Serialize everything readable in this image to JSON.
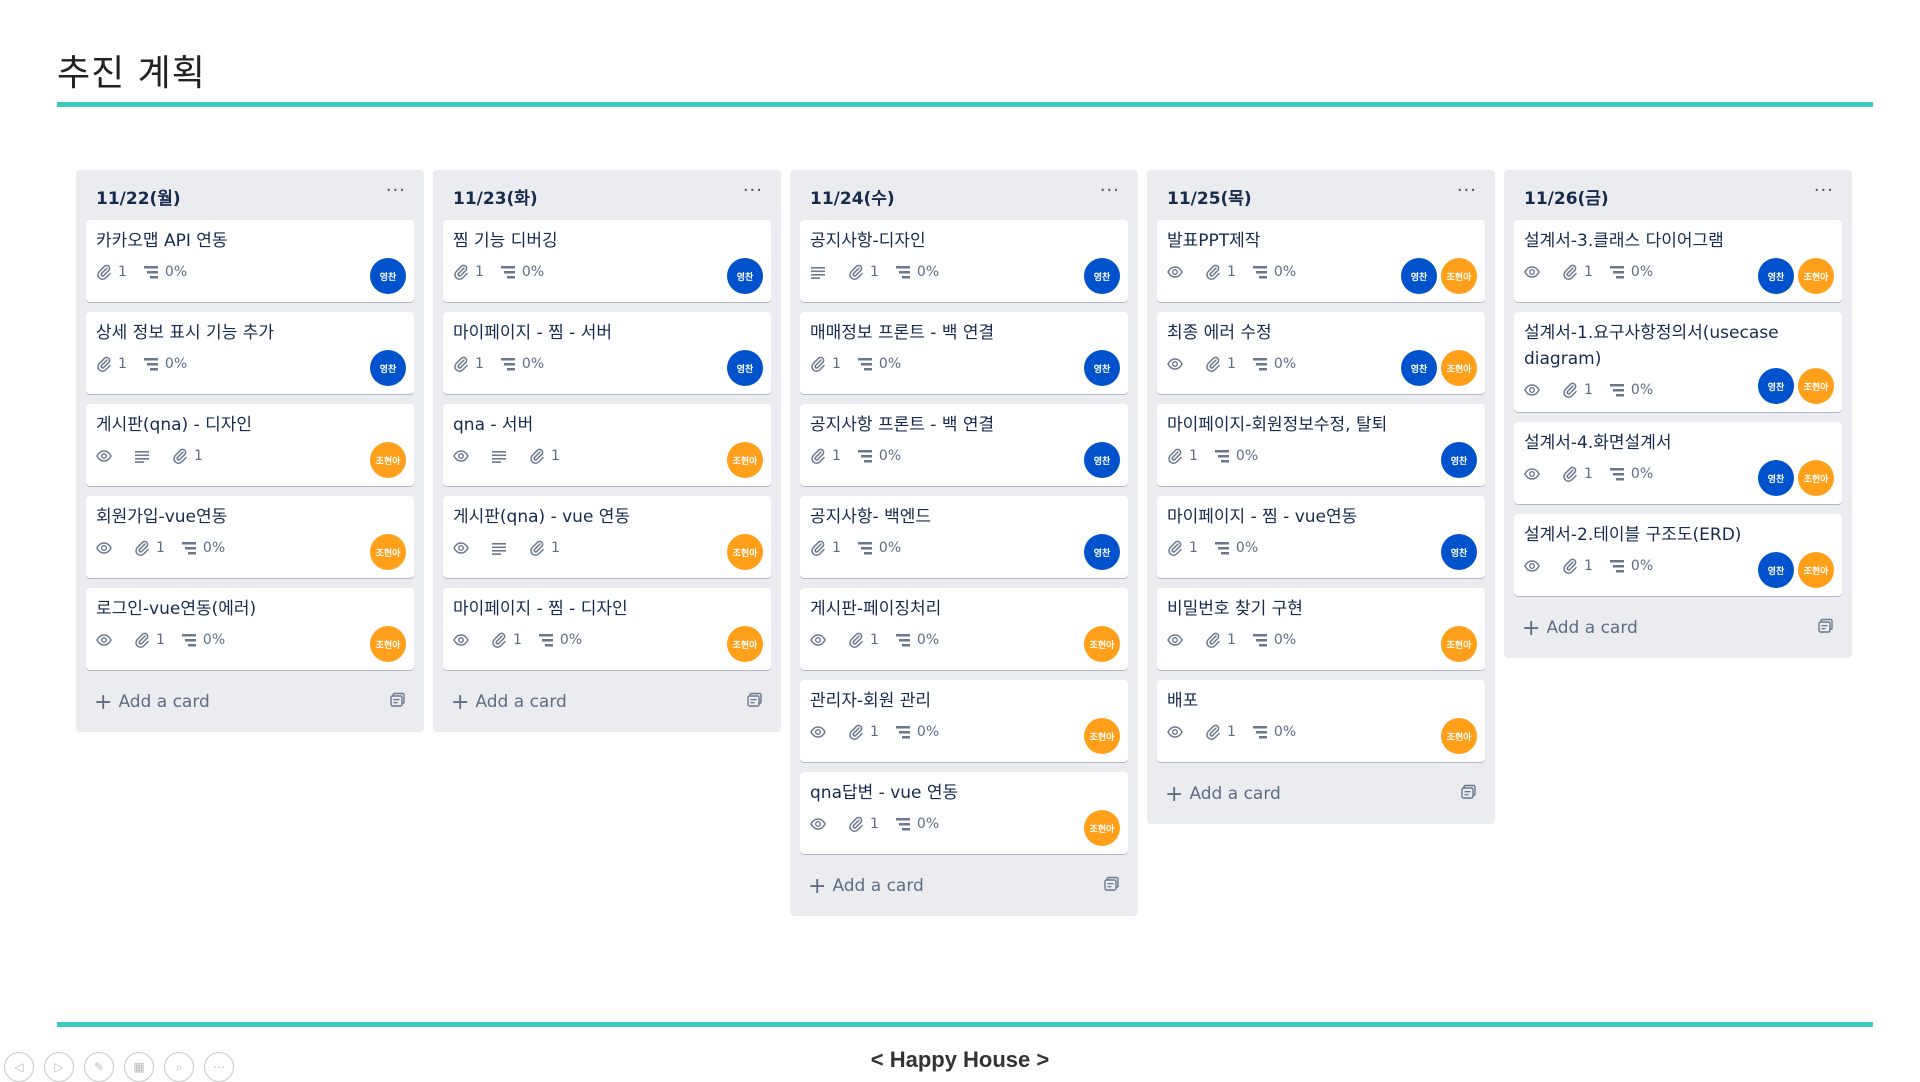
{
  "slide": {
    "title": "추진 계획",
    "footer": "< Happy House >"
  },
  "colors": {
    "accent_rule": "#3bc9c0",
    "avatar_blue": "#0052cc",
    "avatar_orange": "#ff9f1a"
  },
  "add_card_label": "Add a card",
  "list_menu_label": "···",
  "members": {
    "blue": "영찬",
    "orange": "조현아"
  },
  "lists": [
    {
      "title": "11/22(월)",
      "cards": [
        {
          "title": "카카오맵 API 연동",
          "badges": [
            {
              "icon": "attachment-icon",
              "text": "1"
            },
            {
              "icon": "checklist-icon",
              "text": "0%"
            }
          ],
          "members": [
            "blue"
          ]
        },
        {
          "title": "상세 정보 표시 기능 추가",
          "badges": [
            {
              "icon": "attachment-icon",
              "text": "1"
            },
            {
              "icon": "checklist-icon",
              "text": "0%"
            }
          ],
          "members": [
            "blue"
          ]
        },
        {
          "title": "게시판(qna) - 디자인",
          "badges": [
            {
              "icon": "eye-icon",
              "text": ""
            },
            {
              "icon": "description-icon",
              "text": ""
            },
            {
              "icon": "attachment-icon",
              "text": "1"
            }
          ],
          "members": [
            "orange"
          ]
        },
        {
          "title": "회원가입-vue연동",
          "badges": [
            {
              "icon": "eye-icon",
              "text": ""
            },
            {
              "icon": "attachment-icon",
              "text": "1"
            },
            {
              "icon": "checklist-icon",
              "text": "0%"
            }
          ],
          "members": [
            "orange"
          ]
        },
        {
          "title": "로그인-vue연동(에러)",
          "badges": [
            {
              "icon": "eye-icon",
              "text": ""
            },
            {
              "icon": "attachment-icon",
              "text": "1"
            },
            {
              "icon": "checklist-icon",
              "text": "0%"
            }
          ],
          "members": [
            "orange"
          ]
        }
      ]
    },
    {
      "title": "11/23(화)",
      "cards": [
        {
          "title": "찜 기능 디버깅",
          "badges": [
            {
              "icon": "attachment-icon",
              "text": "1"
            },
            {
              "icon": "checklist-icon",
              "text": "0%"
            }
          ],
          "members": [
            "blue"
          ]
        },
        {
          "title": "마이페이지 - 찜 - 서버",
          "badges": [
            {
              "icon": "attachment-icon",
              "text": "1"
            },
            {
              "icon": "checklist-icon",
              "text": "0%"
            }
          ],
          "members": [
            "blue"
          ]
        },
        {
          "title": "qna - 서버",
          "badges": [
            {
              "icon": "eye-icon",
              "text": ""
            },
            {
              "icon": "description-icon",
              "text": ""
            },
            {
              "icon": "attachment-icon",
              "text": "1"
            }
          ],
          "members": [
            "orange"
          ]
        },
        {
          "title": "게시판(qna) - vue 연동",
          "badges": [
            {
              "icon": "eye-icon",
              "text": ""
            },
            {
              "icon": "description-icon",
              "text": ""
            },
            {
              "icon": "attachment-icon",
              "text": "1"
            }
          ],
          "members": [
            "orange"
          ]
        },
        {
          "title": "마이페이지 - 찜 - 디자인",
          "badges": [
            {
              "icon": "eye-icon",
              "text": ""
            },
            {
              "icon": "attachment-icon",
              "text": "1"
            },
            {
              "icon": "checklist-icon",
              "text": "0%"
            }
          ],
          "members": [
            "orange"
          ]
        }
      ]
    },
    {
      "title": "11/24(수)",
      "cards": [
        {
          "title": "공지사항-디자인",
          "badges": [
            {
              "icon": "description-icon",
              "text": ""
            },
            {
              "icon": "attachment-icon",
              "text": "1"
            },
            {
              "icon": "checklist-icon",
              "text": "0%"
            }
          ],
          "members": [
            "blue"
          ]
        },
        {
          "title": "매매정보 프론트 - 백 연결",
          "badges": [
            {
              "icon": "attachment-icon",
              "text": "1"
            },
            {
              "icon": "checklist-icon",
              "text": "0%"
            }
          ],
          "members": [
            "blue"
          ]
        },
        {
          "title": "공지사항 프론트 - 백 연결",
          "badges": [
            {
              "icon": "attachment-icon",
              "text": "1"
            },
            {
              "icon": "checklist-icon",
              "text": "0%"
            }
          ],
          "members": [
            "blue"
          ]
        },
        {
          "title": "공지사항- 백엔드",
          "badges": [
            {
              "icon": "attachment-icon",
              "text": "1"
            },
            {
              "icon": "checklist-icon",
              "text": "0%"
            }
          ],
          "members": [
            "blue"
          ]
        },
        {
          "title": "게시판-페이징처리",
          "badges": [
            {
              "icon": "eye-icon",
              "text": ""
            },
            {
              "icon": "attachment-icon",
              "text": "1"
            },
            {
              "icon": "checklist-icon",
              "text": "0%"
            }
          ],
          "members": [
            "orange"
          ]
        },
        {
          "title": "관리자-회원 관리",
          "badges": [
            {
              "icon": "eye-icon",
              "text": ""
            },
            {
              "icon": "attachment-icon",
              "text": "1"
            },
            {
              "icon": "checklist-icon",
              "text": "0%"
            }
          ],
          "members": [
            "orange"
          ]
        },
        {
          "title": "qna답변 - vue 연동",
          "badges": [
            {
              "icon": "eye-icon",
              "text": ""
            },
            {
              "icon": "attachment-icon",
              "text": "1"
            },
            {
              "icon": "checklist-icon",
              "text": "0%"
            }
          ],
          "members": [
            "orange"
          ]
        }
      ]
    },
    {
      "title": "11/25(목)",
      "cards": [
        {
          "title": "발표PPT제작",
          "badges": [
            {
              "icon": "eye-icon",
              "text": ""
            },
            {
              "icon": "attachment-icon",
              "text": "1"
            },
            {
              "icon": "checklist-icon",
              "text": "0%"
            }
          ],
          "members": [
            "blue",
            "orange"
          ]
        },
        {
          "title": "최종 에러 수정",
          "badges": [
            {
              "icon": "eye-icon",
              "text": ""
            },
            {
              "icon": "attachment-icon",
              "text": "1"
            },
            {
              "icon": "checklist-icon",
              "text": "0%"
            }
          ],
          "members": [
            "blue",
            "orange"
          ]
        },
        {
          "title": "마이페이지-회원정보수정, 탈퇴",
          "badges": [
            {
              "icon": "attachment-icon",
              "text": "1"
            },
            {
              "icon": "checklist-icon",
              "text": "0%"
            }
          ],
          "members": [
            "blue"
          ]
        },
        {
          "title": "마이페이지 - 찜 - vue연동",
          "badges": [
            {
              "icon": "attachment-icon",
              "text": "1"
            },
            {
              "icon": "checklist-icon",
              "text": "0%"
            }
          ],
          "members": [
            "blue"
          ]
        },
        {
          "title": "비밀번호 찾기 구현",
          "badges": [
            {
              "icon": "eye-icon",
              "text": ""
            },
            {
              "icon": "attachment-icon",
              "text": "1"
            },
            {
              "icon": "checklist-icon",
              "text": "0%"
            }
          ],
          "members": [
            "orange"
          ]
        },
        {
          "title": "배포",
          "badges": [
            {
              "icon": "eye-icon",
              "text": ""
            },
            {
              "icon": "attachment-icon",
              "text": "1"
            },
            {
              "icon": "checklist-icon",
              "text": "0%"
            }
          ],
          "members": [
            "orange"
          ]
        }
      ]
    },
    {
      "title": "11/26(금)",
      "cards": [
        {
          "title": "설계서-3.클래스 다이어그램",
          "badges": [
            {
              "icon": "eye-icon",
              "text": ""
            },
            {
              "icon": "attachment-icon",
              "text": "1"
            },
            {
              "icon": "checklist-icon",
              "text": "0%"
            }
          ],
          "members": [
            "blue",
            "orange"
          ]
        },
        {
          "title": "설계서-1.요구사항정의서(usecase diagram)",
          "badges": [
            {
              "icon": "eye-icon",
              "text": ""
            },
            {
              "icon": "attachment-icon",
              "text": "1"
            },
            {
              "icon": "checklist-icon",
              "text": "0%"
            }
          ],
          "members": [
            "blue",
            "orange"
          ]
        },
        {
          "title": "설계서-4.화면설계서",
          "badges": [
            {
              "icon": "eye-icon",
              "text": ""
            },
            {
              "icon": "attachment-icon",
              "text": "1"
            },
            {
              "icon": "checklist-icon",
              "text": "0%"
            }
          ],
          "members": [
            "blue",
            "orange"
          ]
        },
        {
          "title": "설계서-2.테이블 구조도(ERD)",
          "badges": [
            {
              "icon": "eye-icon",
              "text": ""
            },
            {
              "icon": "attachment-icon",
              "text": "1"
            },
            {
              "icon": "checklist-icon",
              "text": "0%"
            }
          ],
          "members": [
            "blue",
            "orange"
          ]
        }
      ]
    }
  ],
  "controls": [
    {
      "name": "prev-slide-icon",
      "glyph": "◁"
    },
    {
      "name": "next-slide-icon",
      "glyph": "▷"
    },
    {
      "name": "pen-icon",
      "glyph": "✎"
    },
    {
      "name": "slides-grid-icon",
      "glyph": "▦"
    },
    {
      "name": "zoom-icon",
      "glyph": "⌕"
    },
    {
      "name": "more-options-icon",
      "glyph": "⋯"
    }
  ]
}
